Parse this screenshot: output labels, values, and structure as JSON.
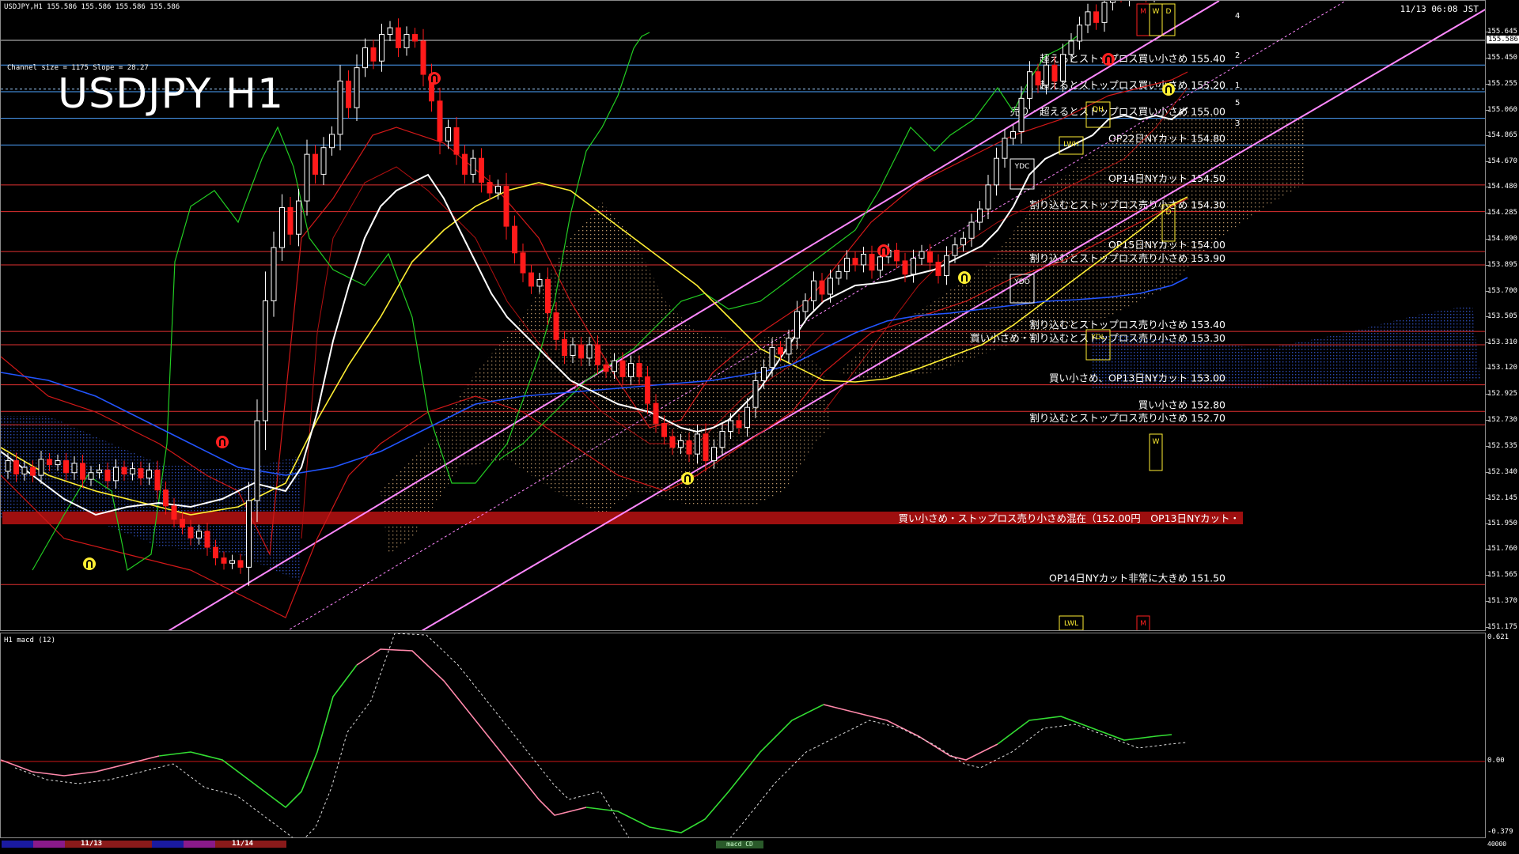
{
  "header": {
    "info": "USDJPY,H1  155.586 155.586 155.586 155.586",
    "server_time": "11/13 06:08",
    "time_suffix": "JST"
  },
  "channel_info": "Channel size = 1175 Slope = 28.27",
  "title": "USDJPY H1",
  "current_price": "155.586",
  "price_axis": [
    "155.645",
    "155.450",
    "155.255",
    "155.060",
    "154.865",
    "154.670",
    "154.480",
    "154.285",
    "154.090",
    "153.895",
    "153.700",
    "153.505",
    "153.310",
    "153.120",
    "152.925",
    "152.730",
    "152.535",
    "152.340",
    "152.145",
    "151.950",
    "151.760",
    "151.565",
    "151.370",
    "151.175"
  ],
  "levels": [
    {
      "price": 155.4,
      "color": "#4da3ff",
      "text": "超えるとストップロス買い小さめ 155.40"
    },
    {
      "price": 155.2,
      "color": "#4da3ff",
      "text": "超えるとストップロス買い小さめ 155.20"
    },
    {
      "price": 155.0,
      "color": "#4da3ff",
      "text": "売り・超えるとストップロス買い小さめ 155.00"
    },
    {
      "price": 154.8,
      "color": "#4da3ff",
      "text": "OP22日NYカット 154.80"
    },
    {
      "price": 154.5,
      "color": "#e03030",
      "text": "OP14日NYカット 154.50"
    },
    {
      "price": 154.3,
      "color": "#e03030",
      "text": "割り込むとストップロス売り小さめ 154.30"
    },
    {
      "price": 154.0,
      "color": "#e03030",
      "text": "OP15日NYカット 154.00"
    },
    {
      "price": 153.9,
      "color": "#e03030",
      "text": "割り込むとストップロス売り小さめ 153.90"
    },
    {
      "price": 153.4,
      "color": "#e03030",
      "text": "割り込むとストップロス売り小さめ 153.40"
    },
    {
      "price": 153.3,
      "color": "#e03030",
      "text": "買い小さめ・割り込むとストップロス売り小さめ 153.30"
    },
    {
      "price": 153.0,
      "color": "#e03030",
      "text": "買い小さめ、OP13日NYカット 153.00"
    },
    {
      "price": 152.8,
      "color": "#e03030",
      "text": "買い小さめ 152.80"
    },
    {
      "price": 152.7,
      "color": "#e03030",
      "text": "割り込むとストップロス売り小さめ 152.70"
    },
    {
      "price": 151.5,
      "color": "#e03030",
      "text": "OP14日NYカット非常に大きめ 151.50"
    }
  ],
  "zone": {
    "price": 152.0,
    "text": "買い小さめ・ストップロス売り小さめ混在（152.00円　OP13日NYカット・"
  },
  "markers": [
    "YDC",
    "YDO",
    "DH",
    "LWH",
    "YDL",
    "LWL",
    "M",
    "W",
    "D",
    "M",
    "W",
    "D"
  ],
  "channel_numbers": [
    "4",
    "2",
    "1",
    "5",
    "3"
  ],
  "macd": {
    "label": "H1  macd (12)",
    "axis": [
      "0.621",
      "0.00",
      "-0.379"
    ]
  },
  "bottom": {
    "dates": [
      "11/13",
      "11/14"
    ],
    "tab": "macd CD",
    "volume": "40000"
  },
  "colors": {
    "bull": "#ffffff",
    "bear": "#ff1a1a",
    "ma_white": "#ffffff",
    "ma_yellow": "#ffee33",
    "ma_blue": "#2255ff",
    "green": "#22cc22",
    "channel": "#ff88ff",
    "kumo": "#c8a070",
    "kumo_blue": "#3355cc"
  }
}
